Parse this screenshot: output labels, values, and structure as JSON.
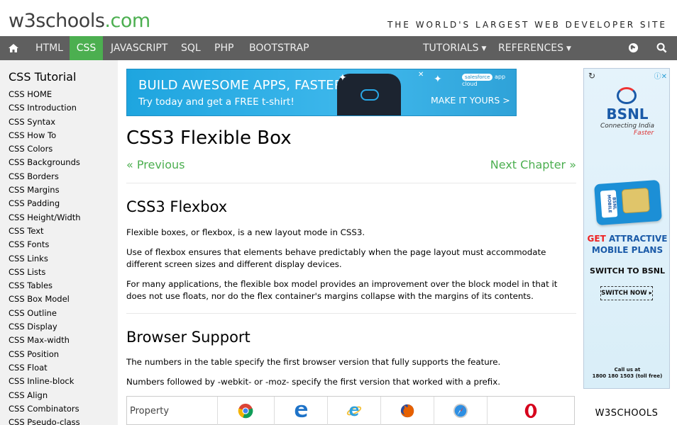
{
  "header": {
    "logo_w3": "w3schools",
    "logo_com": ".com",
    "tagline": "THE WORLD'S LARGEST WEB DEVELOPER SITE"
  },
  "nav": {
    "home_icon": "home-icon",
    "items": [
      "HTML",
      "CSS",
      "JAVASCRIPT",
      "SQL",
      "PHP",
      "BOOTSTRAP"
    ],
    "tutorials": "TUTORIALS",
    "references": "REFERENCES",
    "globe_icon": "globe-icon",
    "search_icon": "search-icon",
    "active": "CSS",
    "accent": "#4CAF50"
  },
  "sidebar": {
    "title": "CSS Tutorial",
    "links": [
      "CSS HOME",
      "CSS Introduction",
      "CSS Syntax",
      "CSS How To",
      "CSS Colors",
      "CSS Backgrounds",
      "CSS Borders",
      "CSS Margins",
      "CSS Padding",
      "CSS Height/Width",
      "CSS Text",
      "CSS Fonts",
      "CSS Links",
      "CSS Lists",
      "CSS Tables",
      "CSS Box Model",
      "CSS Outline",
      "CSS Display",
      "CSS Max-width",
      "CSS Position",
      "CSS Float",
      "CSS Inline-block",
      "CSS Align",
      "CSS Combinators",
      "CSS Pseudo-class"
    ]
  },
  "banner": {
    "line1": "BUILD AWESOME APPS, FASTER",
    "line2": "Try today and get a FREE t-shirt!",
    "brand": "salesforce",
    "brand_suffix": "app cloud",
    "cta": "MAKE IT YOURS >"
  },
  "main": {
    "title": "CSS3 Flexible Box",
    "prev": "« Previous",
    "next": "Next Chapter »",
    "h2_flexbox": "CSS3 Flexbox",
    "p1": "Flexible boxes, or flexbox, is a new layout mode in CSS3.",
    "p2": "Use of flexbox ensures that elements behave predictably when the page layout must accommodate different screen sizes and different display devices.",
    "p3": "For many applications, the flexible box model provides an improvement over the block model in that it does not use floats, nor do the flex container's margins collapse with the margins of its contents.",
    "h2_support": "Browser Support",
    "p4": "The numbers in the table specify the first browser version that fully supports the feature.",
    "p5": "Numbers followed by -webkit- or -moz- specify the first version that worked with a prefix.",
    "table_header": "Property",
    "browser_icons": [
      "chrome-icon",
      "edge-icon",
      "ie-icon",
      "firefox-icon",
      "safari-icon",
      "opera-icon"
    ]
  },
  "ad": {
    "brand": "BSNL",
    "tagline": "Connecting India",
    "tagline2": "Faster",
    "sim_label": "BSNL MOBILE",
    "get": "GET",
    "attractive": "ATTRACTIVE",
    "mobile_plans": "MOBILE PLANS",
    "switch": "SWITCH TO BSNL",
    "switch_btn": "SWITCH NOW ▸",
    "call_line1": "Call us at",
    "call_line2": "1800 180 1503 (toll free)"
  },
  "footer_right": "W3SCHOOLS"
}
